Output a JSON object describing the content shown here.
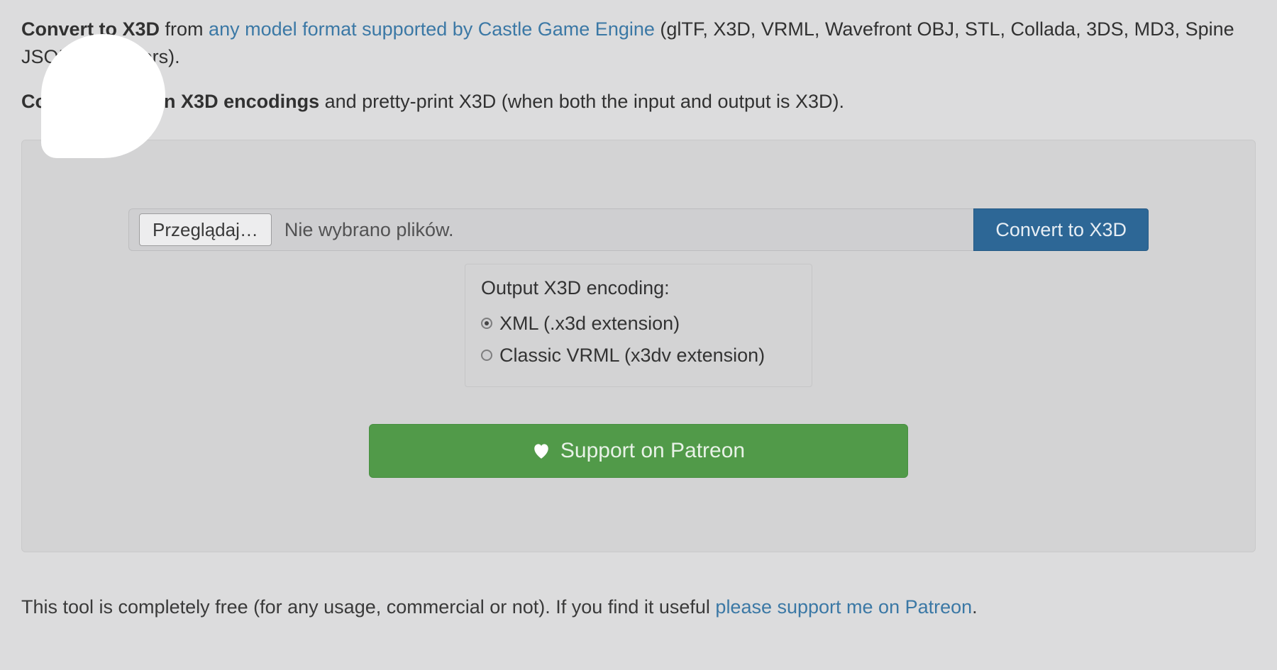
{
  "intro": {
    "para1_strong": "Convert to X3D",
    "para1_after_strong": " from ",
    "para1_link": "any model format supported by Castle Game Engine",
    "para1_tail": " (glTF, X3D, VRML, Wavefront OBJ, STL, Collada, 3DS, MD3, Spine JSON and others).",
    "para2_strong": "Convert between X3D encodings",
    "para2_tail": " and pretty-print X3D (when both the input and output is X3D)."
  },
  "form": {
    "browse_label": "Przeglądaj…",
    "file_status": "Nie wybrano plików.",
    "convert_label": "Convert to X3D",
    "encoding_heading": "Output X3D encoding:",
    "options": [
      {
        "label": "XML (.x3d extension)",
        "selected": true
      },
      {
        "label": "Classic VRML (x3dv extension)",
        "selected": false
      }
    ],
    "patreon_label": "Support on Patreon"
  },
  "footer": {
    "text_before": "This tool is completely free (for any usage, commercial or not). If you find it useful ",
    "link_text": "please support me on Patreon",
    "text_after": "."
  }
}
